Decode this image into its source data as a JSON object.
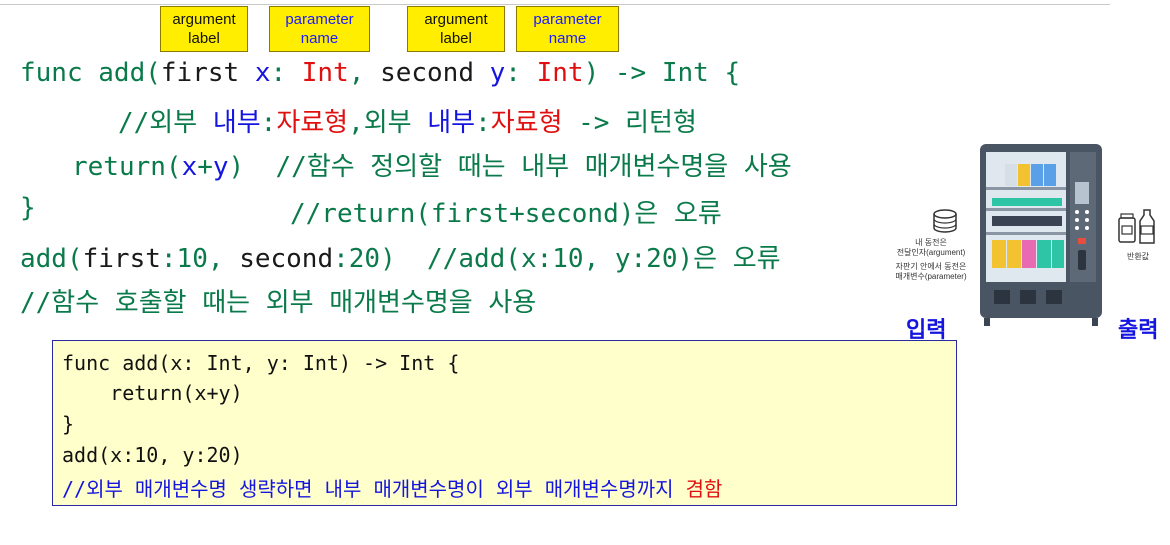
{
  "callouts": [
    {
      "line1": "argument",
      "line2": "label"
    },
    {
      "line1": "parameter",
      "line2": "name"
    },
    {
      "line1": "argument",
      "line2": "label"
    },
    {
      "line1": "parameter",
      "line2": "name"
    }
  ],
  "code": {
    "l1": {
      "a": "func add(",
      "b": "first ",
      "c": "x",
      "d": ": ",
      "e": "Int",
      "f": ", ",
      "g": "second ",
      "h": "y",
      "i": ": ",
      "j": "Int",
      "k": ") -> Int {"
    },
    "l2": {
      "a": "//외부 ",
      "b": "내부",
      "c": ":",
      "d": "자료형",
      "e": ",외부 ",
      "f": "내부",
      "g": ":",
      "h": "자료형",
      "i": " -> 리턴형"
    },
    "l3": {
      "a": "return(",
      "b": "x",
      "c": "+",
      "d": "y",
      "e": ")  //함수 정의할 때는 내부 매개변수명을 사용"
    },
    "l4": {
      "a": "}",
      "b": "//return(first+second)은 오류"
    },
    "l5": {
      "a": "add(",
      "b": "first",
      "c": ":10, ",
      "d": "second",
      "e": ":20)  //add(x:10, y:20)은 오류"
    },
    "l6": {
      "a": "//함수 호출할 때는 외부 매개변수명을 사용"
    }
  },
  "box": {
    "l1": "func add(x: Int, y: Int) -> Int {",
    "l2": "    return(x+y)",
    "l3": "}",
    "l4": "add(x:10, y:20)",
    "l5a": "//외부 매개변수명 생략하면 내부 매개변수명이 외부 매개변수명까지 ",
    "l5b": "겸함"
  },
  "illustration": {
    "input_label": "입력",
    "output_label": "출력",
    "coin_caption1": "내 동전은",
    "coin_caption2": "전달인자(argument)",
    "slot_caption1": "자판기 안에서 동전은",
    "slot_caption2": "매개변수(parameter)",
    "return_caption": "반환값"
  },
  "colors": {
    "callout_bg": "#ffee00",
    "code_green": "#0a7a4a",
    "code_blue": "#1515e0",
    "code_red": "#e01010",
    "box_bg": "#ffffcc"
  }
}
